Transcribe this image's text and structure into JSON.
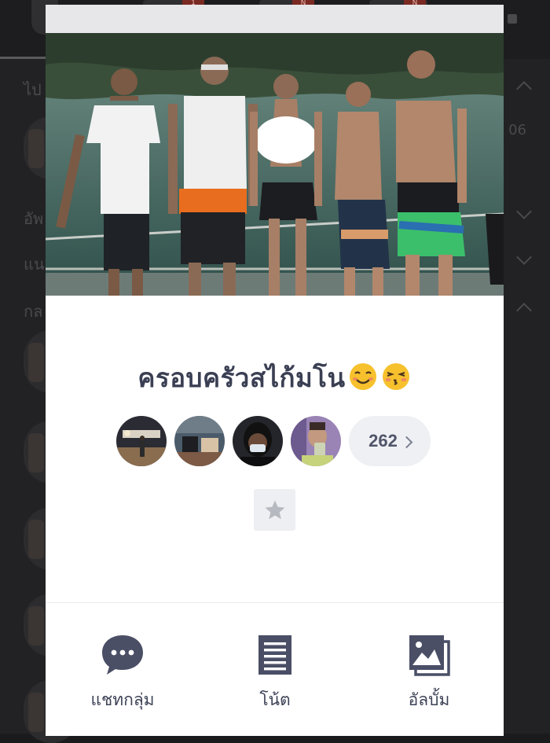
{
  "background": {
    "badges": [
      "1",
      "N",
      "N"
    ],
    "side_text": "06",
    "header_texts": [
      "ไป",
      "อัพ",
      "แน",
      "กล"
    ]
  },
  "group": {
    "name": "ครอบครัวสไก้มโน",
    "member_count": "262"
  },
  "actions": {
    "chat_label": "แชทกลุ่ม",
    "note_label": "โน้ต",
    "album_label": "อัลบั้ม"
  },
  "icons": {
    "chat": "chat-bubble-icon",
    "note": "note-document-icon",
    "album": "photo-album-icon",
    "favorite": "star-icon",
    "count": "chevron-right-icon"
  },
  "colors": {
    "accent": "#3d4256",
    "icon": "#4a4f66",
    "pill_bg": "#eef0f3",
    "scrim": "#1b1b1d"
  }
}
